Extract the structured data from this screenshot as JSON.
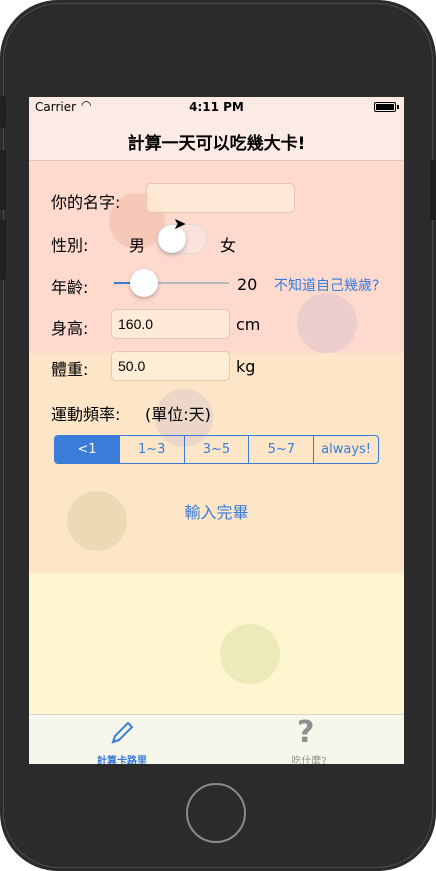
{
  "status": {
    "carrier": "Carrier",
    "time": "4:11 PM"
  },
  "nav": {
    "title": "計算一天可以吃幾大卡!"
  },
  "form": {
    "name_label": "你的名字:",
    "name_value": "",
    "gender_label": "性別:",
    "gender_male": "男",
    "gender_female": "女",
    "age_label": "年齡:",
    "age_value": "20",
    "age_unknown_link": "不知道自己幾歲?",
    "height_label": "身高:",
    "height_value": "160.0",
    "height_unit": "cm",
    "weight_label": "體重:",
    "weight_value": "50.0",
    "weight_unit": "kg",
    "exercise_label": "運動頻率:",
    "exercise_unit": "(單位:天)",
    "exercise_options": [
      "<1",
      "1~3",
      "3~5",
      "5~7",
      "always!"
    ],
    "exercise_selected": "<1",
    "submit_label": "輸入完畢"
  },
  "tabs": [
    {
      "label": "計算卡路里",
      "icon": "pencil-icon",
      "selected": true
    },
    {
      "label": "吃什麼?",
      "icon": "question-icon",
      "selected": false
    }
  ],
  "colors": {
    "accent": "#3a7dd8",
    "nav_bg": "#fcebe5",
    "pink_bg": "#fdd9ce",
    "yellow_bg": "#fff6cf"
  }
}
